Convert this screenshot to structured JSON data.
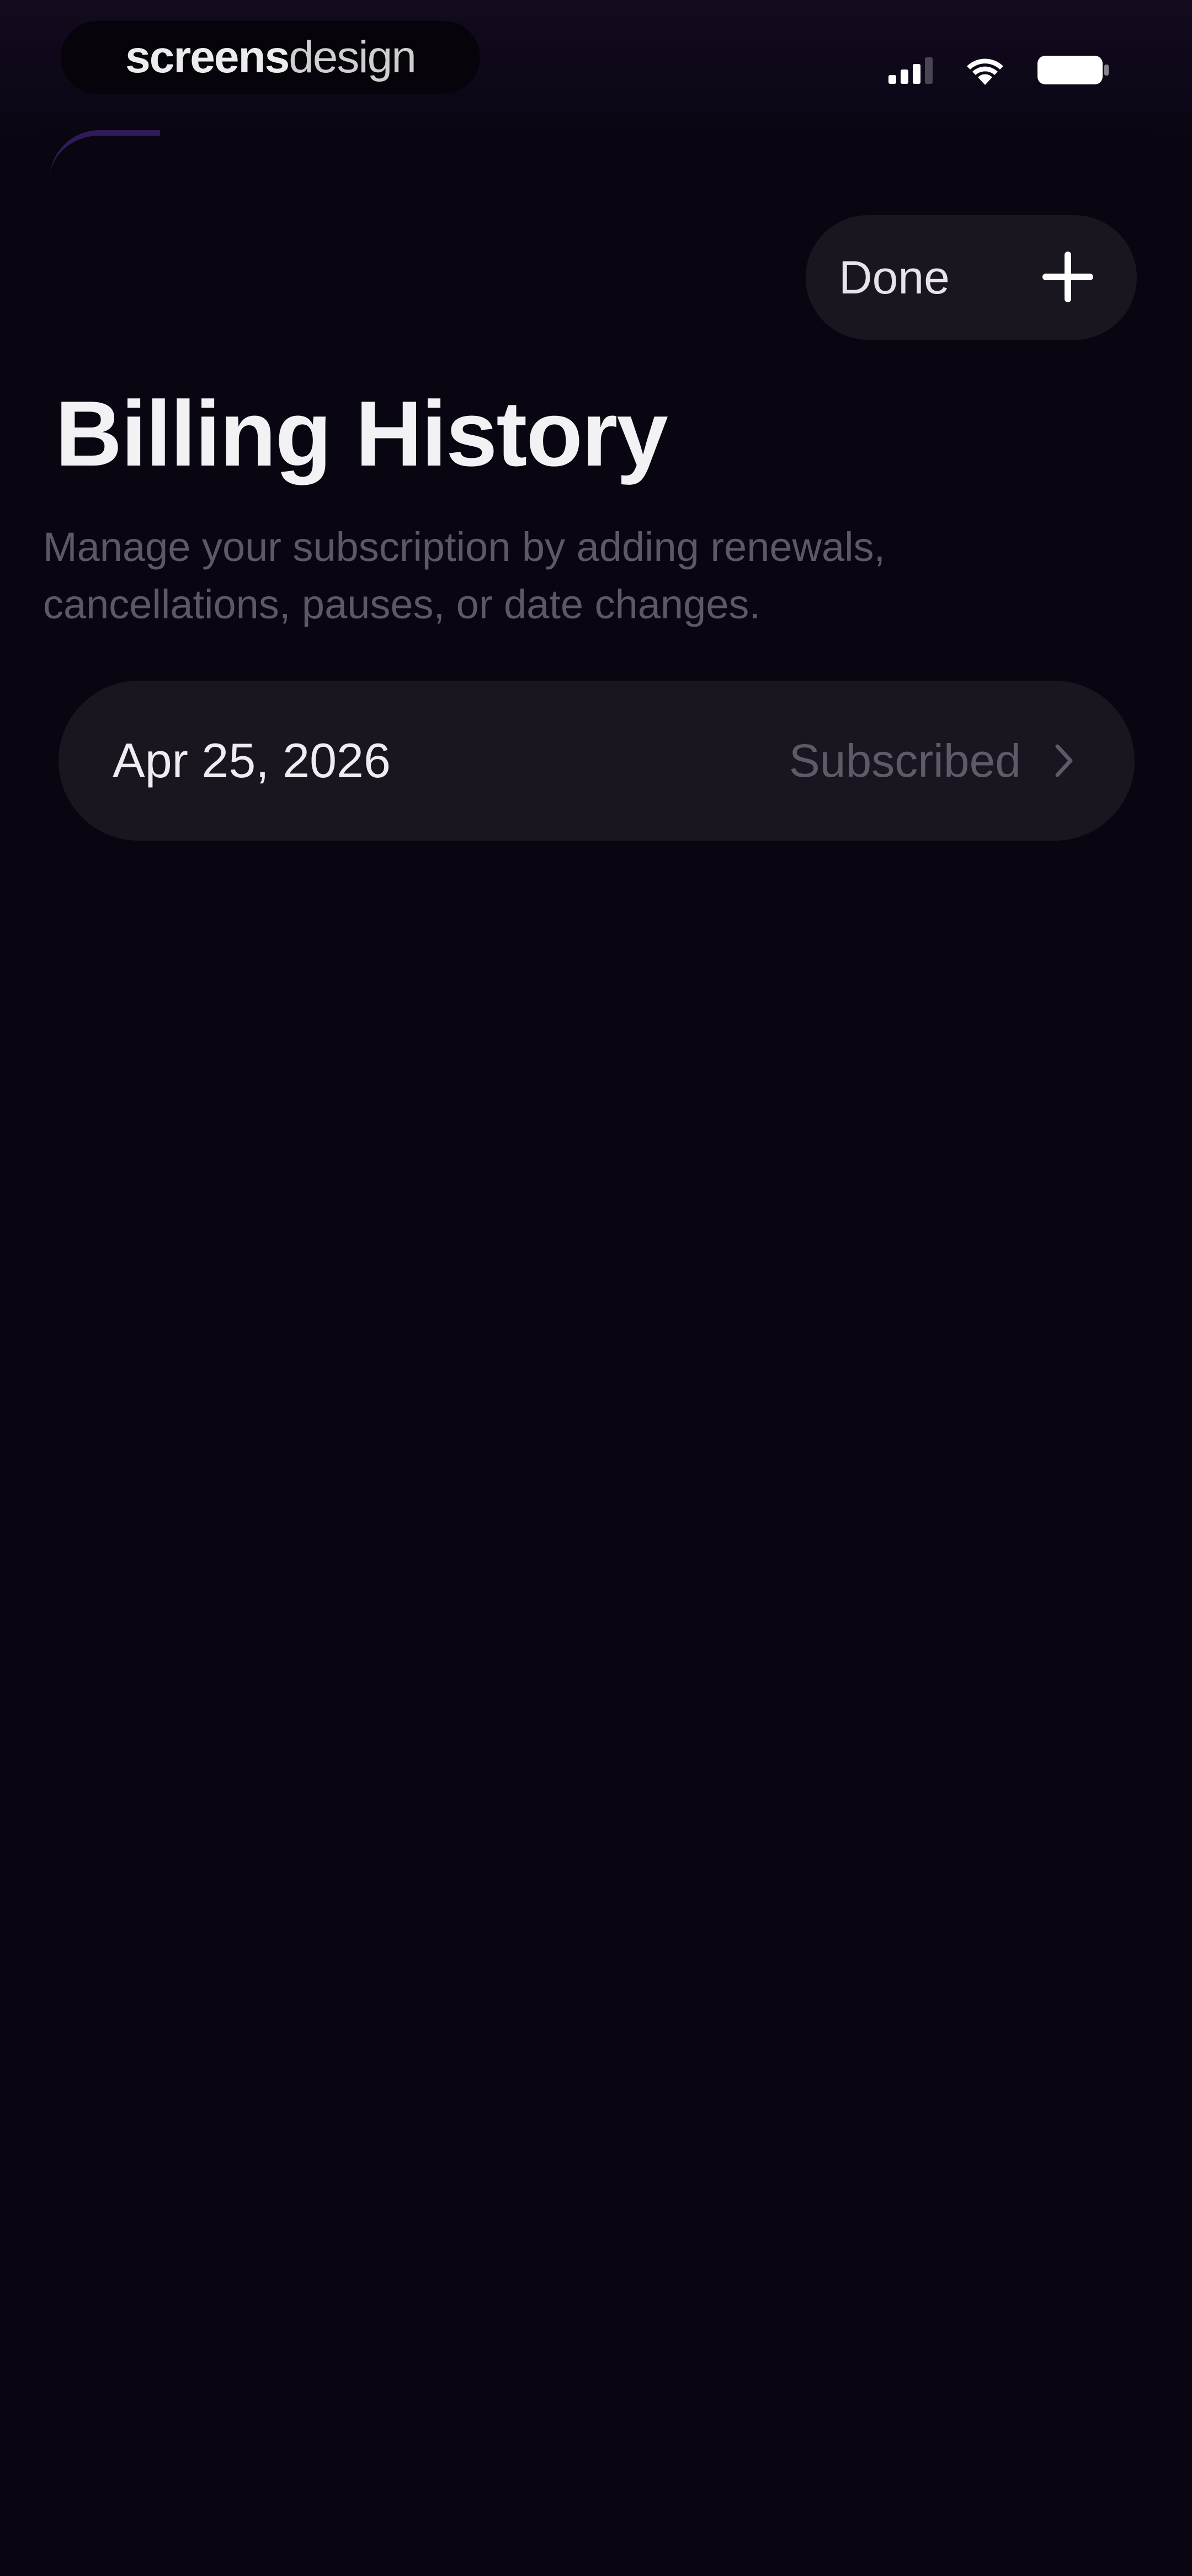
{
  "status_bar": {
    "brand_part1": "screens",
    "brand_part2": "design",
    "signal_icon": "cellular-signal-icon",
    "wifi_icon": "wifi-icon",
    "battery_icon": "battery-icon"
  },
  "toolbar": {
    "done_label": "Done",
    "add_icon": "plus-icon"
  },
  "header": {
    "title": "Billing History",
    "subtitle": "Manage your subscription by adding renewals, cancellations, pauses, or date changes."
  },
  "billing_items": [
    {
      "date": "Apr 25, 2026",
      "status": "Subscribed",
      "icon": "chevron-right-icon"
    }
  ],
  "colors": {
    "background": "#090611",
    "card": "#1a1620",
    "muted_text": "#5f5a69",
    "accent_glow": "#4a2a8a"
  }
}
